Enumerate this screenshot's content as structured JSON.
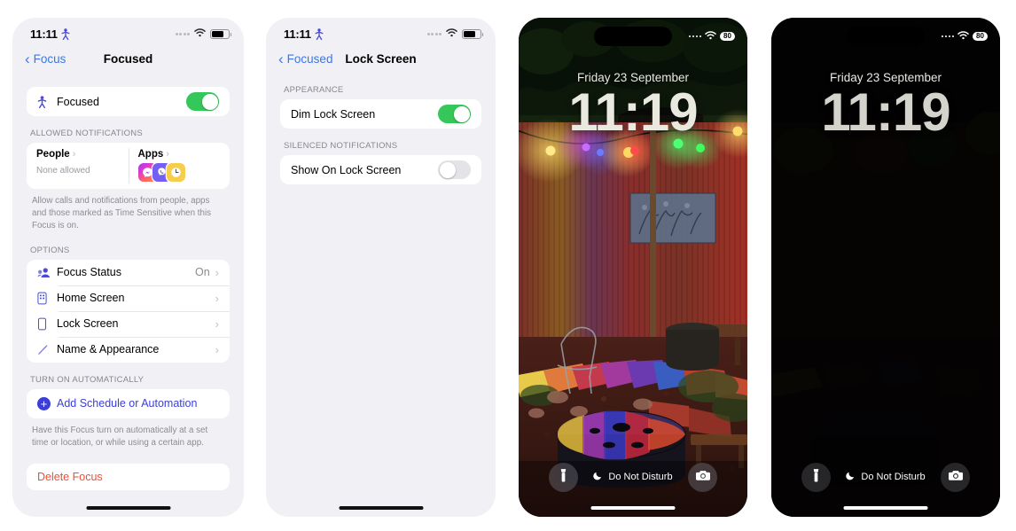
{
  "panels": {
    "focused_settings": {
      "status": {
        "time": "11:11",
        "focus_icon": "focus-person-icon",
        "battery_icon": "battery-icon",
        "wifi_icon": "wifi-icon"
      },
      "nav": {
        "back_label": "Focus",
        "title": "Focused"
      },
      "focus_toggle_row": {
        "label": "Focused",
        "icon": "focus-person-icon",
        "state": "on"
      },
      "allowed_notifications": {
        "header": "ALLOWED NOTIFICATIONS",
        "people": {
          "title": "People",
          "subtitle": "None allowed"
        },
        "apps": {
          "title": "Apps",
          "icons": [
            "messenger-icon",
            "viber-icon",
            "clock-icon"
          ]
        },
        "footnote": "Allow calls and notifications from people, apps and those marked as Time Sensitive when this Focus is on."
      },
      "options": {
        "header": "OPTIONS",
        "items": [
          {
            "label": "Focus Status",
            "value": "On",
            "icon": "people-status-icon"
          },
          {
            "label": "Home Screen",
            "value": "",
            "icon": "home-screen-icon"
          },
          {
            "label": "Lock Screen",
            "value": "",
            "icon": "lock-screen-icon"
          },
          {
            "label": "Name & Appearance",
            "value": "",
            "icon": "pencil-icon"
          }
        ]
      },
      "automation": {
        "header": "TURN ON AUTOMATICALLY",
        "add_label": "Add Schedule or Automation",
        "add_icon": "plus-circle-icon",
        "footnote": "Have this Focus turn on automatically at a set time or location, or while using a certain app."
      },
      "delete_label": "Delete Focus"
    },
    "lock_screen_settings": {
      "status": {
        "time": "11:11",
        "focus_icon": "focus-person-icon"
      },
      "nav": {
        "back_label": "Focused",
        "title": "Lock Screen"
      },
      "appearance": {
        "header": "APPEARANCE",
        "row": {
          "label": "Dim Lock Screen",
          "state": "on"
        }
      },
      "silenced": {
        "header": "SILENCED NOTIFICATIONS",
        "row": {
          "label": "Show On Lock Screen",
          "state": "off"
        }
      }
    },
    "lock_screen_bright": {
      "status": {
        "battery_percent": "80",
        "wifi_icon": "wifi-icon"
      },
      "date": "Friday 23 September",
      "time": "11:19",
      "dnd_label": "Do Not Disturb",
      "dnd_icon": "moon-icon",
      "left_button_icon": "flashlight-icon",
      "right_button_icon": "camera-icon"
    },
    "lock_screen_dimmed": {
      "status": {
        "battery_percent": "80",
        "wifi_icon": "wifi-icon"
      },
      "date": "Friday 23 September",
      "time": "11:19",
      "dnd_label": "Do Not Disturb",
      "dnd_icon": "moon-icon",
      "left_button_icon": "flashlight-icon",
      "right_button_icon": "camera-icon"
    }
  },
  "colors": {
    "toggle_on": "#35c759",
    "toggle_off": "#e3e3e8",
    "accent_blue": "#3b76e8",
    "tint_indigo": "#3b3fd6",
    "danger_red": "#e8513a",
    "settings_bg": "#f1f1f5"
  }
}
